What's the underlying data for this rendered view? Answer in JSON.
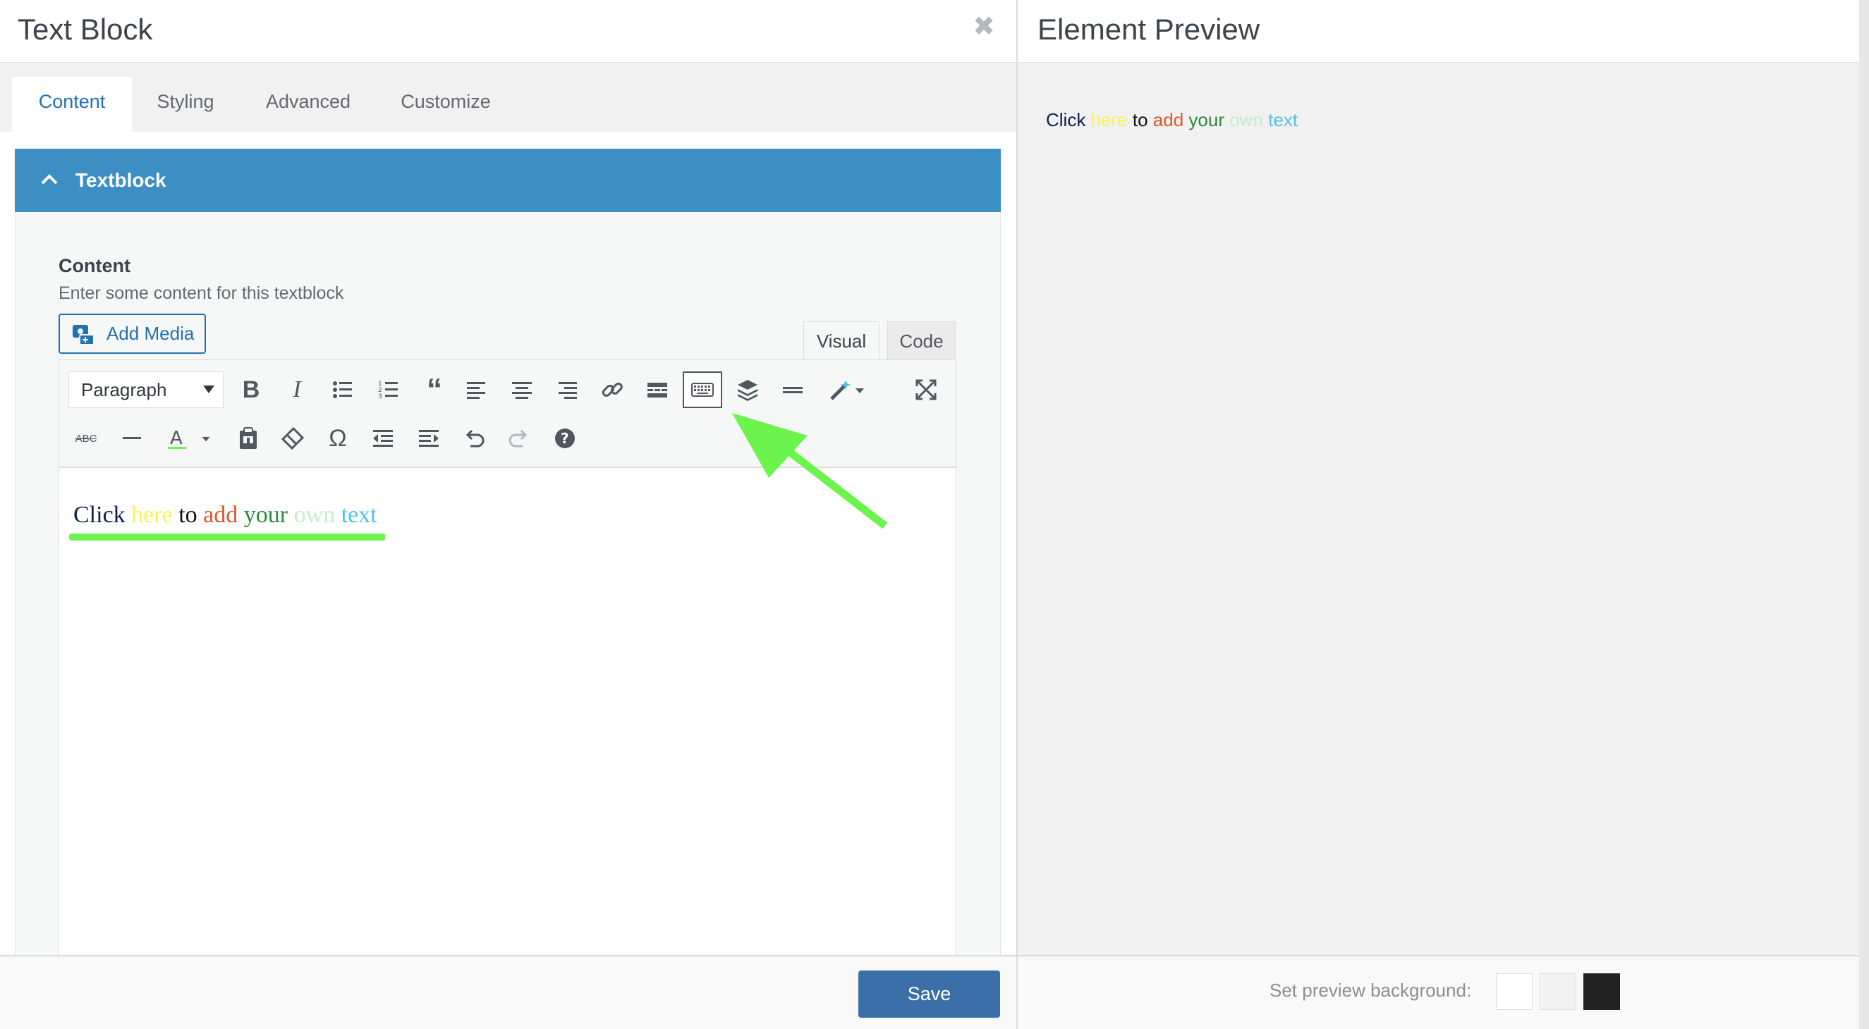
{
  "header": {
    "title": "Text Block",
    "close_icon": "close-icon"
  },
  "tabs": [
    {
      "label": "Content",
      "active": true
    },
    {
      "label": "Styling",
      "active": false
    },
    {
      "label": "Advanced",
      "active": false
    },
    {
      "label": "Customize",
      "active": false
    }
  ],
  "panel": {
    "title": "Textblock"
  },
  "field": {
    "title": "Content",
    "description": "Enter some content for this textblock",
    "add_media_label": "Add Media"
  },
  "editor": {
    "mode_tabs": {
      "visual": "Visual",
      "code": "Code"
    },
    "format_select": "Paragraph",
    "content_words": [
      {
        "text": "Click",
        "color": "#0d1f4e"
      },
      {
        "text": "here",
        "color": "#f9f25a"
      },
      {
        "text": "to",
        "color": "#111111"
      },
      {
        "text": "add",
        "color": "#e0562a"
      },
      {
        "text": "your",
        "color": "#2e8a3a"
      },
      {
        "text": "own",
        "color": "#c7ecc9"
      },
      {
        "text": "text",
        "color": "#4fc2e6"
      }
    ]
  },
  "footer": {
    "save_label": "Save"
  },
  "preview": {
    "title": "Element Preview",
    "background_label": "Set preview background:",
    "swatches": [
      "#ffffff",
      "#f1f1f1",
      "#222222"
    ]
  },
  "colors": {
    "accent": "#3d8ec2",
    "save": "#3a6fa8",
    "annotation": "#6cf44c"
  }
}
